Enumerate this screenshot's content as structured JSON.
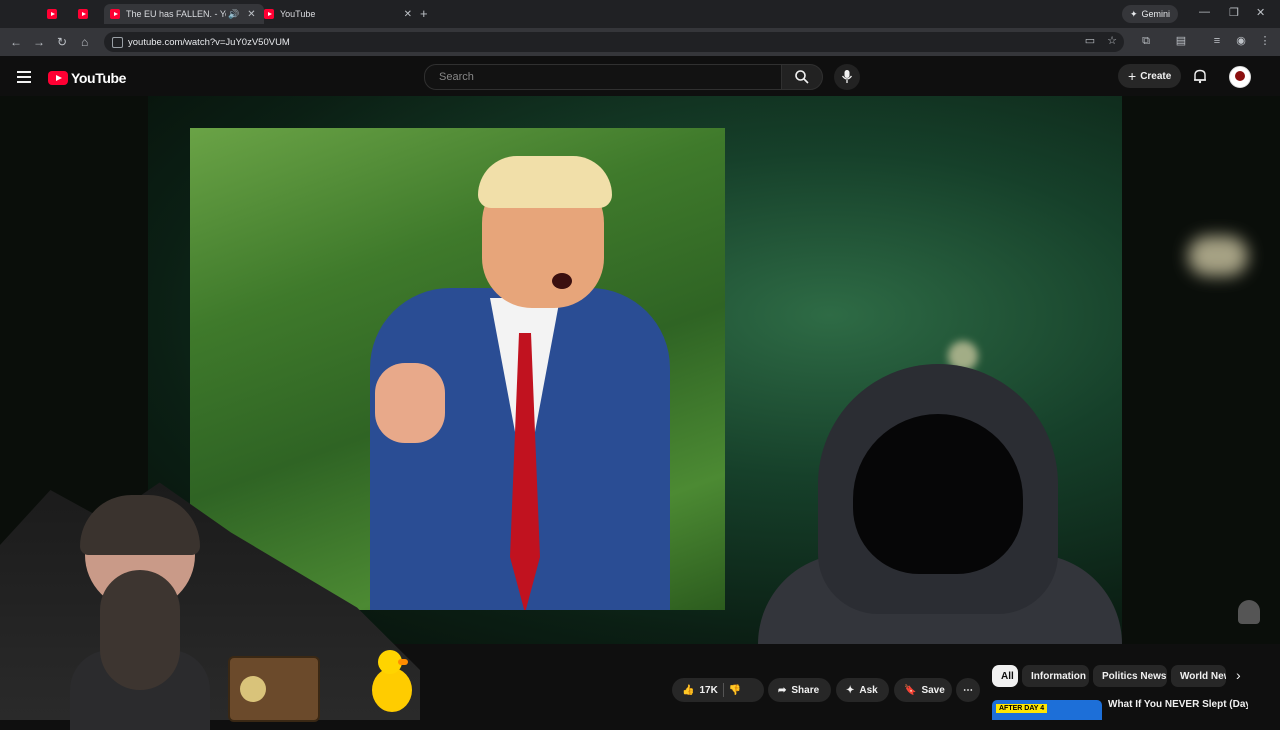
{
  "browser": {
    "tabs": [
      {
        "label": ""
      },
      {
        "label": ""
      },
      {
        "label": "The EU has FALLEN. - YouTu"
      },
      {
        "label": "YouTube"
      }
    ],
    "new_tab_symbol": "+",
    "gemini_label": "Gemini",
    "url": "youtube.com/watch?v=JuY0zV50VUM"
  },
  "youtube": {
    "logo_text": "YouTube",
    "search_placeholder": "Search",
    "create_label": "Create"
  },
  "actions": {
    "like_count": "17K",
    "share_label": "Share",
    "ask_label": "Ask",
    "save_label": "Save"
  },
  "chips": [
    "All",
    "Information",
    "Politics News",
    "World New"
  ],
  "recommendation": {
    "title": "What If You NEVER Slept (Day",
    "thumb_tag": "AFTER DAY 4"
  },
  "colors": {
    "youtube_red": "#ff0033",
    "background": "#0f0f0f",
    "chip_bg": "#272727"
  }
}
